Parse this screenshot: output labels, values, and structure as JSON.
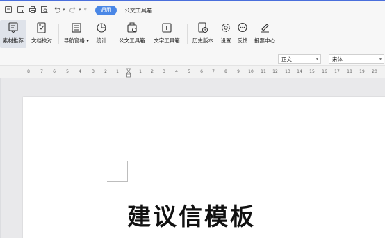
{
  "header": {
    "active_tab": "通用",
    "title": "公文工具箱"
  },
  "ribbon": {
    "items": [
      {
        "label": "素材推荐",
        "icon": "material-recommend-icon"
      },
      {
        "label": "文档校对",
        "icon": "doc-proofread-icon"
      },
      {
        "label": "导航窗格 ▾",
        "icon": "nav-pane-icon"
      },
      {
        "label": "统计",
        "icon": "statistics-icon"
      },
      {
        "label": "公文工具箱",
        "icon": "official-toolbox-icon"
      },
      {
        "label": "文字工具箱",
        "icon": "text-toolbox-icon"
      },
      {
        "label": "历史版本",
        "icon": "history-icon"
      },
      {
        "label": "设置",
        "icon": "gear-icon"
      },
      {
        "label": "反馈",
        "icon": "feedback-icon"
      },
      {
        "label": "投票中心",
        "icon": "vote-icon"
      }
    ]
  },
  "styles": {
    "paragraph_style": "正文",
    "font": "宋体"
  },
  "ruler": {
    "left": [
      "8",
      "7",
      "6",
      "5",
      "4",
      "3",
      "2",
      "1"
    ],
    "right": [
      "1",
      "2",
      "3",
      "4",
      "5",
      "6",
      "7",
      "8",
      "9",
      "10",
      "11",
      "12",
      "13",
      "14",
      "15",
      "16",
      "17",
      "18",
      "19",
      "20"
    ]
  },
  "document": {
    "title": "建议信模板"
  },
  "colors": {
    "accent": "#4a87e6"
  }
}
